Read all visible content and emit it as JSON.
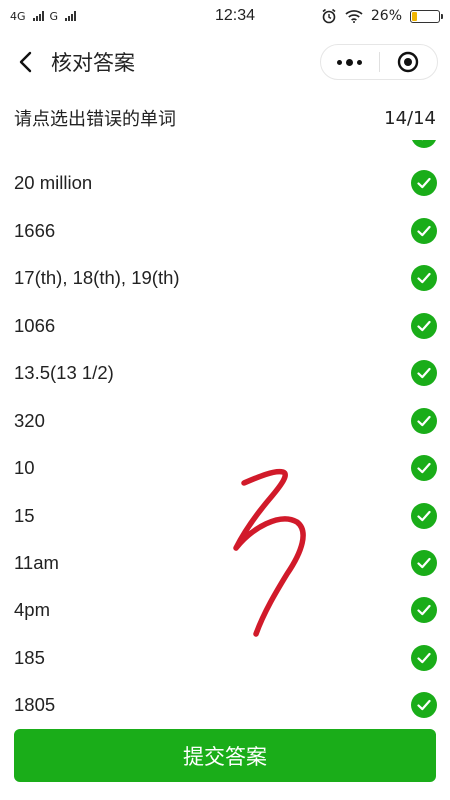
{
  "status_bar": {
    "network_1": "4G",
    "network_2": "G",
    "time": "12:34",
    "battery_percent": "26%",
    "battery_level": 0.26,
    "icons": [
      "alarm-icon",
      "wifi-icon",
      "battery-icon"
    ]
  },
  "nav": {
    "title": "核对答案",
    "icons": [
      "back-icon",
      "more-icon",
      "close-target-icon"
    ]
  },
  "instruction": {
    "text": "请点选出错误的单词",
    "counter": "14/14"
  },
  "items": [
    {
      "label": "20 million",
      "status": "correct"
    },
    {
      "label": "1666",
      "status": "correct"
    },
    {
      "label": "17(th), 18(th), 19(th)",
      "status": "correct"
    },
    {
      "label": "1066",
      "status": "correct"
    },
    {
      "label": "13.5(13 1/2)",
      "status": "correct"
    },
    {
      "label": "320",
      "status": "correct"
    },
    {
      "label": "10",
      "status": "correct"
    },
    {
      "label": "15",
      "status": "correct"
    },
    {
      "label": "11am",
      "status": "correct"
    },
    {
      "label": "4pm",
      "status": "correct"
    },
    {
      "label": "185",
      "status": "correct"
    },
    {
      "label": "1805",
      "status": "correct"
    }
  ],
  "submit_label": "提交答案",
  "colors": {
    "accent_green": "#1aad19",
    "annotation_red": "#d11a2a"
  }
}
